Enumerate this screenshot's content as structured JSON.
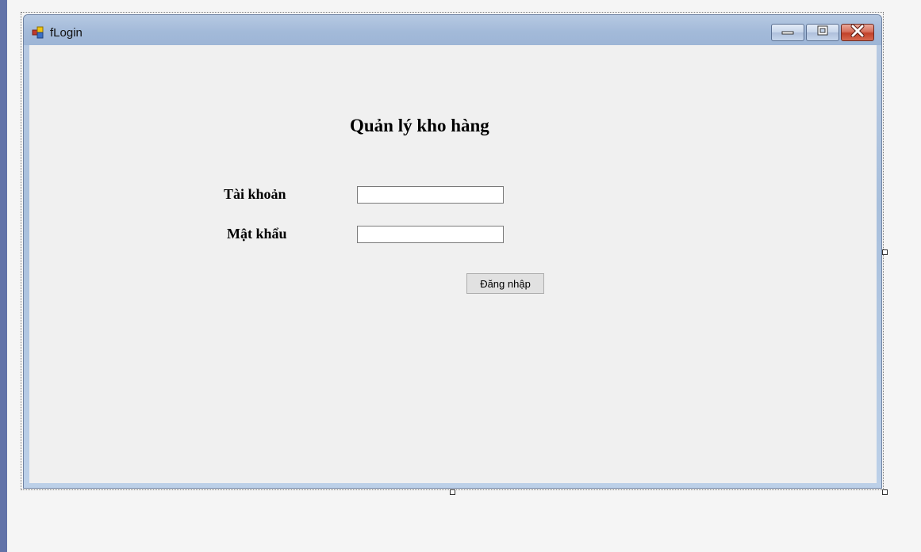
{
  "window": {
    "title": "fLogin"
  },
  "form": {
    "heading": "Quản lý kho hàng",
    "username_label": "Tài khoản",
    "username_value": "",
    "password_label": "Mật khẩu",
    "password_value": "",
    "login_button": "Đăng nhập"
  },
  "icons": {
    "app": "form-icon",
    "minimize": "minimize-icon",
    "maximize": "maximize-icon",
    "close": "close-icon"
  },
  "colors": {
    "titlebar": "#a3bad9",
    "client_background": "#f0f0f0",
    "close_button": "#c2412a",
    "designer_strip": "#6273a8"
  }
}
